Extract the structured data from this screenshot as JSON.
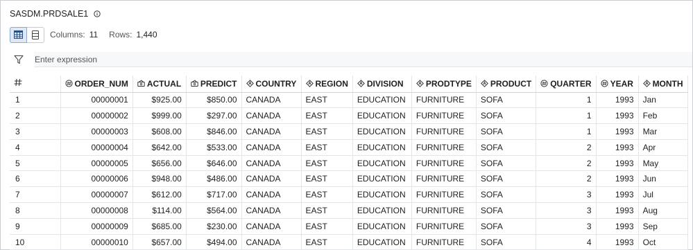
{
  "header": {
    "title": "SASDM.PRDSALE1",
    "info_icon": "info-icon"
  },
  "toolbar": {
    "columns_label": "Columns:",
    "columns_value": "11",
    "rows_label": "Rows:",
    "rows_value": "1,440"
  },
  "filter": {
    "placeholder": "Enter expression",
    "icon": "filter-icon"
  },
  "table": {
    "columns": [
      {
        "label": "ORDER_NUM",
        "icon": "numeric-icon"
      },
      {
        "label": "ACTUAL",
        "icon": "currency-icon"
      },
      {
        "label": "PREDICT",
        "icon": "currency-icon"
      },
      {
        "label": "COUNTRY",
        "icon": "character-icon"
      },
      {
        "label": "REGION",
        "icon": "character-icon"
      },
      {
        "label": "DIVISION",
        "icon": "character-icon"
      },
      {
        "label": "PRODTYPE",
        "icon": "character-icon"
      },
      {
        "label": "PRODUCT",
        "icon": "character-icon"
      },
      {
        "label": "QUARTER",
        "icon": "numeric-icon"
      },
      {
        "label": "YEAR",
        "icon": "numeric-icon"
      },
      {
        "label": "MONTH",
        "icon": "character-icon"
      }
    ],
    "rows": [
      [
        "1",
        "00000001",
        "$925.00",
        "$850.00",
        "CANADA",
        "EAST",
        "EDUCATION",
        "FURNITURE",
        "SOFA",
        "1",
        "1993",
        "Jan"
      ],
      [
        "2",
        "00000002",
        "$999.00",
        "$297.00",
        "CANADA",
        "EAST",
        "EDUCATION",
        "FURNITURE",
        "SOFA",
        "1",
        "1993",
        "Feb"
      ],
      [
        "3",
        "00000003",
        "$608.00",
        "$846.00",
        "CANADA",
        "EAST",
        "EDUCATION",
        "FURNITURE",
        "SOFA",
        "1",
        "1993",
        "Mar"
      ],
      [
        "4",
        "00000004",
        "$642.00",
        "$533.00",
        "CANADA",
        "EAST",
        "EDUCATION",
        "FURNITURE",
        "SOFA",
        "2",
        "1993",
        "Apr"
      ],
      [
        "5",
        "00000005",
        "$656.00",
        "$646.00",
        "CANADA",
        "EAST",
        "EDUCATION",
        "FURNITURE",
        "SOFA",
        "2",
        "1993",
        "May"
      ],
      [
        "6",
        "00000006",
        "$948.00",
        "$486.00",
        "CANADA",
        "EAST",
        "EDUCATION",
        "FURNITURE",
        "SOFA",
        "2",
        "1993",
        "Jun"
      ],
      [
        "7",
        "00000007",
        "$612.00",
        "$717.00",
        "CANADA",
        "EAST",
        "EDUCATION",
        "FURNITURE",
        "SOFA",
        "3",
        "1993",
        "Jul"
      ],
      [
        "8",
        "00000008",
        "$114.00",
        "$564.00",
        "CANADA",
        "EAST",
        "EDUCATION",
        "FURNITURE",
        "SOFA",
        "3",
        "1993",
        "Aug"
      ],
      [
        "9",
        "00000009",
        "$685.00",
        "$230.00",
        "CANADA",
        "EAST",
        "EDUCATION",
        "FURNITURE",
        "SOFA",
        "3",
        "1993",
        "Sep"
      ],
      [
        "10",
        "00000010",
        "$657.00",
        "$494.00",
        "CANADA",
        "EAST",
        "EDUCATION",
        "FURNITURE",
        "SOFA",
        "4",
        "1993",
        "Oct"
      ]
    ]
  }
}
